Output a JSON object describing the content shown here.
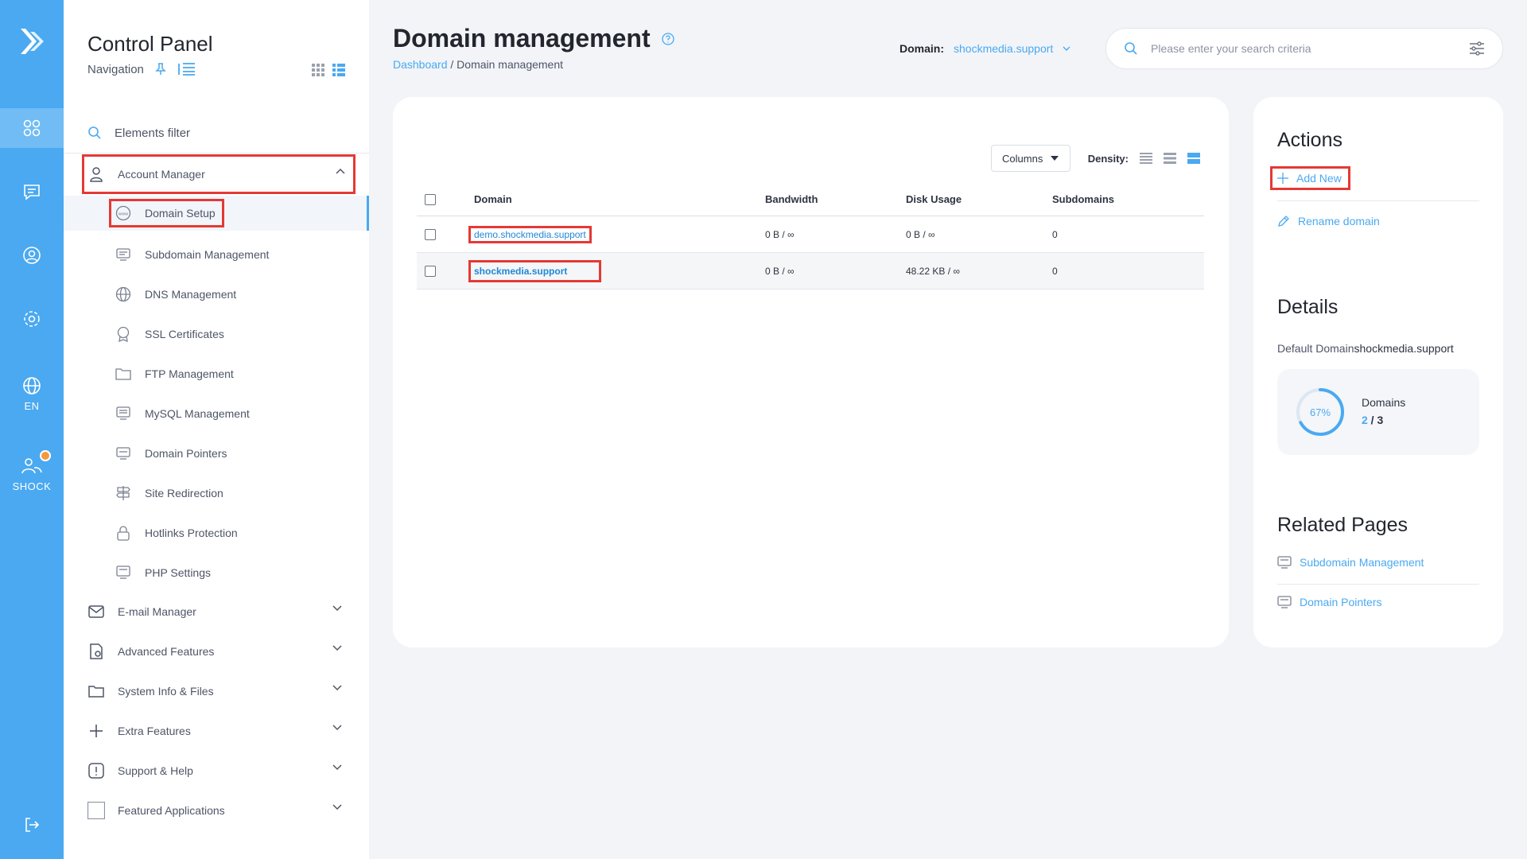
{
  "rail": {
    "lang_label": "EN",
    "user_label": "SHOCK"
  },
  "sidebar": {
    "title": "Control Panel",
    "subtitle": "Navigation",
    "filter_label": "Elements filter",
    "account_manager": "Account Manager",
    "sub_items": [
      "Domain Setup",
      "Subdomain Management",
      "DNS Management",
      "SSL Certificates",
      "FTP Management",
      "MySQL Management",
      "Domain Pointers",
      "Site Redirection",
      "Hotlinks Protection",
      "PHP Settings"
    ],
    "sections": [
      "E-mail Manager",
      "Advanced Features",
      "System Info & Files",
      "Extra Features",
      "Support & Help",
      "Featured Applications"
    ]
  },
  "header": {
    "title": "Domain management",
    "breadcrumb_home": "Dashboard",
    "breadcrumb_sep": " / ",
    "breadcrumb_current": "Domain management",
    "domain_label": "Domain:",
    "domain_value": "shockmedia.support",
    "search_placeholder": "Please enter your search criteria"
  },
  "table": {
    "columns_btn": "Columns",
    "density_label": "Density:",
    "headers": [
      "Domain",
      "Bandwidth",
      "Disk Usage",
      "Subdomains"
    ],
    "rows": [
      {
        "domain": "demo.shockmedia.support",
        "bandwidth": "0 B / ∞",
        "disk": "0 B / ∞",
        "subdomains": "0"
      },
      {
        "domain": "shockmedia.support",
        "bandwidth": "0 B / ∞",
        "disk": "48.22 KB / ∞",
        "subdomains": "0"
      }
    ]
  },
  "side": {
    "actions_title": "Actions",
    "add_new": "Add New",
    "rename": "Rename domain",
    "details_title": "Details",
    "default_domain_label": "Default Domain",
    "default_domain_value": "shockmedia.support",
    "stat_pct": "67%",
    "stat_fraction": 0.67,
    "stat_label": "Domains",
    "stat_used": "2",
    "stat_sep": " / ",
    "stat_total": "3",
    "related_title": "Related Pages",
    "related": [
      "Subdomain Management",
      "Domain Pointers"
    ]
  },
  "colors": {
    "accent": "#4aa9f1",
    "highlight": "#e53935",
    "dot": "#f39a3b"
  }
}
